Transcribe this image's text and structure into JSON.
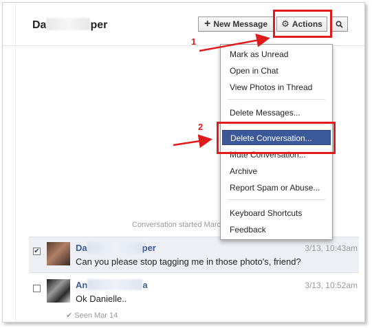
{
  "header": {
    "conversation_title_start": "Da",
    "conversation_title_end": "per",
    "new_message_label": "New Message",
    "actions_label": "Actions"
  },
  "annotations": {
    "step1": "1",
    "step2": "2",
    "color": "#e01b1b"
  },
  "actions_menu": {
    "group1": [
      "Mark as Unread",
      "Open in Chat",
      "View Photos in Thread"
    ],
    "group2": [
      "Delete Messages..."
    ],
    "group3": [
      "Delete Conversation...",
      "Mute Conversation...",
      "Archive",
      "Report Spam or Abuse..."
    ],
    "group4": [
      "Keyboard Shortcuts",
      "Feedback"
    ]
  },
  "conversation_started": "Conversation started Marc",
  "messages": [
    {
      "sender_start": "Da",
      "sender_end": "per",
      "time": "3/13, 10:43am",
      "text": "Can you please stop tagging me in those photo's, friend?",
      "checked": true
    },
    {
      "sender_start": "An",
      "sender_end": "a",
      "time": "3/13, 10:52am",
      "text": "Ok Danielle..",
      "checked": false
    }
  ],
  "seen_status": "Seen Mar 14",
  "colors": {
    "accent": "#3b5998",
    "highlight_bg": "#3b5998",
    "selected_row_bg": "#edeff4"
  },
  "icons": {
    "new_message": "plus-icon",
    "actions": "gear-icon",
    "search": "search-icon",
    "seen": "checkmark-icon"
  }
}
